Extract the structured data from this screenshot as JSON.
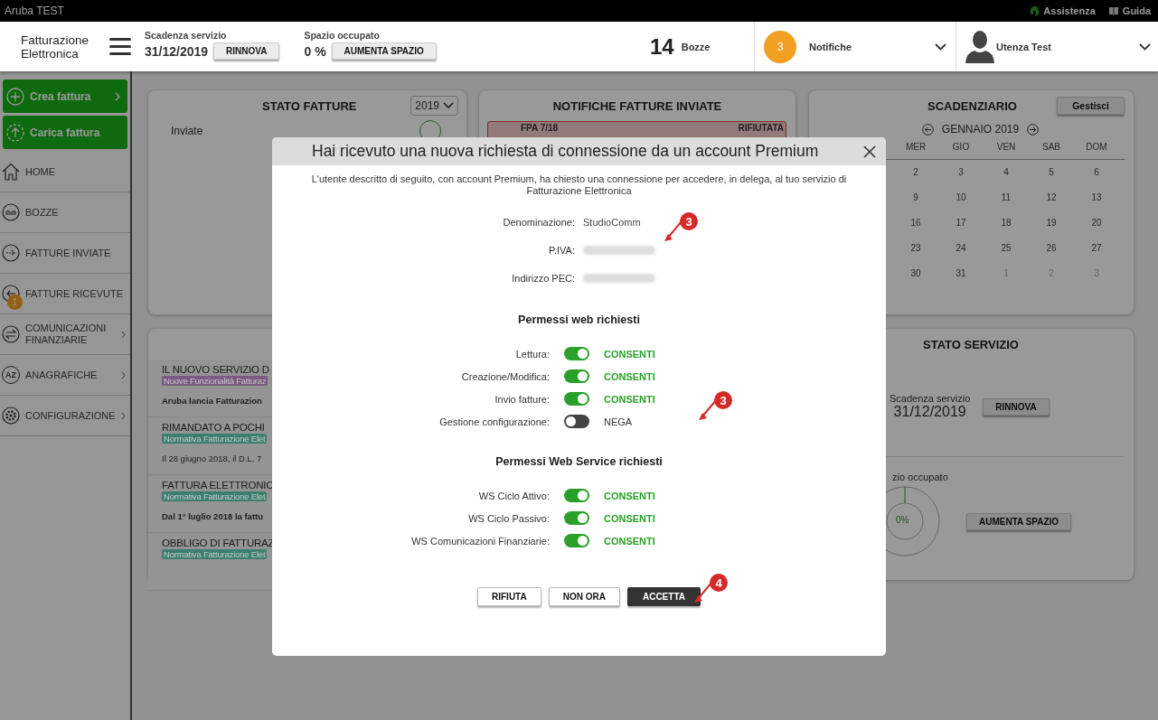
{
  "topbar": {
    "brand": "Aruba TEST",
    "links": [
      {
        "label": "Assistenza",
        "kind": "support"
      },
      {
        "label": "Guida",
        "kind": "guide"
      }
    ]
  },
  "header": {
    "logo_lines": [
      "Fatturazione",
      "Elettronica"
    ],
    "expiry": {
      "label": "Scadenza servizio",
      "value": "31/12/2019",
      "button": "RINNOVA"
    },
    "space": {
      "label": "Spazio occupato",
      "value": "0 %",
      "button": "AUMENTA SPAZIO"
    },
    "drafts": {
      "count": "14",
      "label": "Bozze"
    },
    "notifications": {
      "count": "3",
      "label": "Notifiche"
    },
    "user": {
      "name": "Utenza Test"
    }
  },
  "sidebar": {
    "actions": [
      {
        "label": "Crea fattura",
        "kind": "create",
        "chevron": true
      },
      {
        "label": "Carica fattura",
        "kind": "upload",
        "chevron": false
      }
    ],
    "items": [
      {
        "label": "HOME",
        "kind": "home",
        "chevron": false
      },
      {
        "label": "BOZZE",
        "kind": "drafts",
        "chevron": false
      },
      {
        "label": "FATTURE INVIATE",
        "kind": "sent",
        "chevron": false
      },
      {
        "label": "FATTURE RICEVUTE",
        "kind": "received",
        "chevron": false,
        "badge": "1"
      },
      {
        "label": "COMUNICAZIONI FINANZIARIE",
        "kind": "exchange",
        "chevron": true
      },
      {
        "label": "ANAGRAFICHE",
        "kind": "letters",
        "icon_text": "AZ",
        "chevron": true
      },
      {
        "label": "CONFIGURAZIONE",
        "kind": "settings",
        "chevron": true
      }
    ]
  },
  "invoice_status": {
    "title": "STATO FATTURE",
    "year": "2019",
    "rows": [
      {
        "label": "Inviate"
      }
    ]
  },
  "sent_notifications": {
    "title": "NOTIFICHE FATTURE INVIATE",
    "items": [
      {
        "number": "FPA 7/18",
        "status": "RIFIUTATA"
      }
    ]
  },
  "calendar": {
    "title": "SCADENZIARIO",
    "button": "Gestisci",
    "month": "GENNAIO 2019",
    "weekdays": [
      "MER",
      "GIO",
      "VEN",
      "SAB",
      "DOM"
    ],
    "weeks": [
      [
        {
          "day": "2",
          "other_month": false
        },
        {
          "day": "3",
          "other_month": false
        },
        {
          "day": "4",
          "other_month": false
        },
        {
          "day": "5",
          "other_month": false
        },
        {
          "day": "6",
          "other_month": false
        }
      ],
      [
        {
          "day": "9",
          "other_month": false
        },
        {
          "day": "10",
          "other_month": false
        },
        {
          "day": "11",
          "other_month": false
        },
        {
          "day": "12",
          "other_month": false
        },
        {
          "day": "13",
          "other_month": false
        }
      ],
      [
        {
          "day": "16",
          "other_month": false
        },
        {
          "day": "17",
          "other_month": false
        },
        {
          "day": "18",
          "other_month": false
        },
        {
          "day": "19",
          "other_month": false
        },
        {
          "day": "20",
          "other_month": false
        }
      ],
      [
        {
          "day": "23",
          "other_month": false
        },
        {
          "day": "24",
          "other_month": false
        },
        {
          "day": "25",
          "other_month": false
        },
        {
          "day": "26",
          "other_month": false
        },
        {
          "day": "27",
          "other_month": false
        }
      ],
      [
        {
          "day": "30",
          "other_month": false
        },
        {
          "day": "31",
          "other_month": false
        },
        {
          "day": "1",
          "other_month": true
        },
        {
          "day": "2",
          "other_month": true
        },
        {
          "day": "3",
          "other_month": true
        }
      ]
    ]
  },
  "news": {
    "items": [
      {
        "title": "IL NUOVO SERVIZIO D",
        "tag": "Nuove Funzionalità Fatturaz",
        "color": "#7a5983",
        "excerpt": "Aruba lancia Fatturazion",
        "emphasis": true
      },
      {
        "title": "RIMANDATO A POCHI",
        "tag": "Normativa Fatturazione Elet",
        "color": "#3d7f6e",
        "excerpt": "Il 28 giugno 2018, il D.L. 7",
        "emphasis": false
      },
      {
        "title": "FATTURA ELETTRONIC",
        "tag": "Normativa Fatturazione Elet",
        "color": "#3d7f6e",
        "excerpt": "Dal 1° luglio 2018 la fattu",
        "emphasis": true
      },
      {
        "title": "OBBLIGO DI FATTURAZ",
        "tag": "Normativa Fatturazione Elet",
        "color": "#3d7f6e"
      }
    ]
  },
  "service_status": {
    "title": "STATO SERVIZIO",
    "expiry_label": "Scadenza servizio",
    "expiry_value": "31/12/2019",
    "renew_button": "RINNOVA",
    "space_label": "zio occupato",
    "usage": "0%",
    "space_button": "AUMENTA SPAZIO"
  },
  "dialog": {
    "title": "Hai ricevuto una nuova richiesta di connessione da un account Premium",
    "intro": "L'utente descritto di seguito, con account Premium, ha chiesto una connessione per accedere, in delega, al tuo servizio di Fatturazione Elettronica",
    "fields": [
      {
        "label": "Denominazione:",
        "value": "StudioComm"
      },
      {
        "label": "P.IVA:",
        "blurred": true
      },
      {
        "label": "Indirizzo PEC:",
        "blurred": true
      }
    ],
    "sections": [
      {
        "heading": "Permessi web richiesti",
        "permissions": [
          {
            "label": "Lettura:",
            "on": true,
            "status": "CONSENTI"
          },
          {
            "label": "Creazione/Modifica:",
            "on": true,
            "status": "CONSENTI"
          },
          {
            "label": "Invio fatture:",
            "on": true,
            "status": "CONSENTI"
          },
          {
            "label": "Gestione configurazione:",
            "on": false,
            "status": "NEGA"
          }
        ]
      },
      {
        "heading": "Permessi Web Service richiesti",
        "permissions": [
          {
            "label": "WS Ciclo Attivo:",
            "on": true,
            "status": "CONSENTI"
          },
          {
            "label": "WS Ciclo Passivo:",
            "on": true,
            "status": "CONSENTI"
          },
          {
            "label": "WS Comunicazioni Finanziarie:",
            "on": true,
            "status": "CONSENTI"
          }
        ]
      }
    ],
    "buttons": [
      {
        "label": "RIFIUTA",
        "primary": false
      },
      {
        "label": "NON ORA",
        "primary": false
      },
      {
        "label": "ACCETTA",
        "primary": true
      }
    ]
  },
  "annotations": [
    {
      "number": "3"
    },
    {
      "number": "3"
    },
    {
      "number": "4"
    }
  ]
}
